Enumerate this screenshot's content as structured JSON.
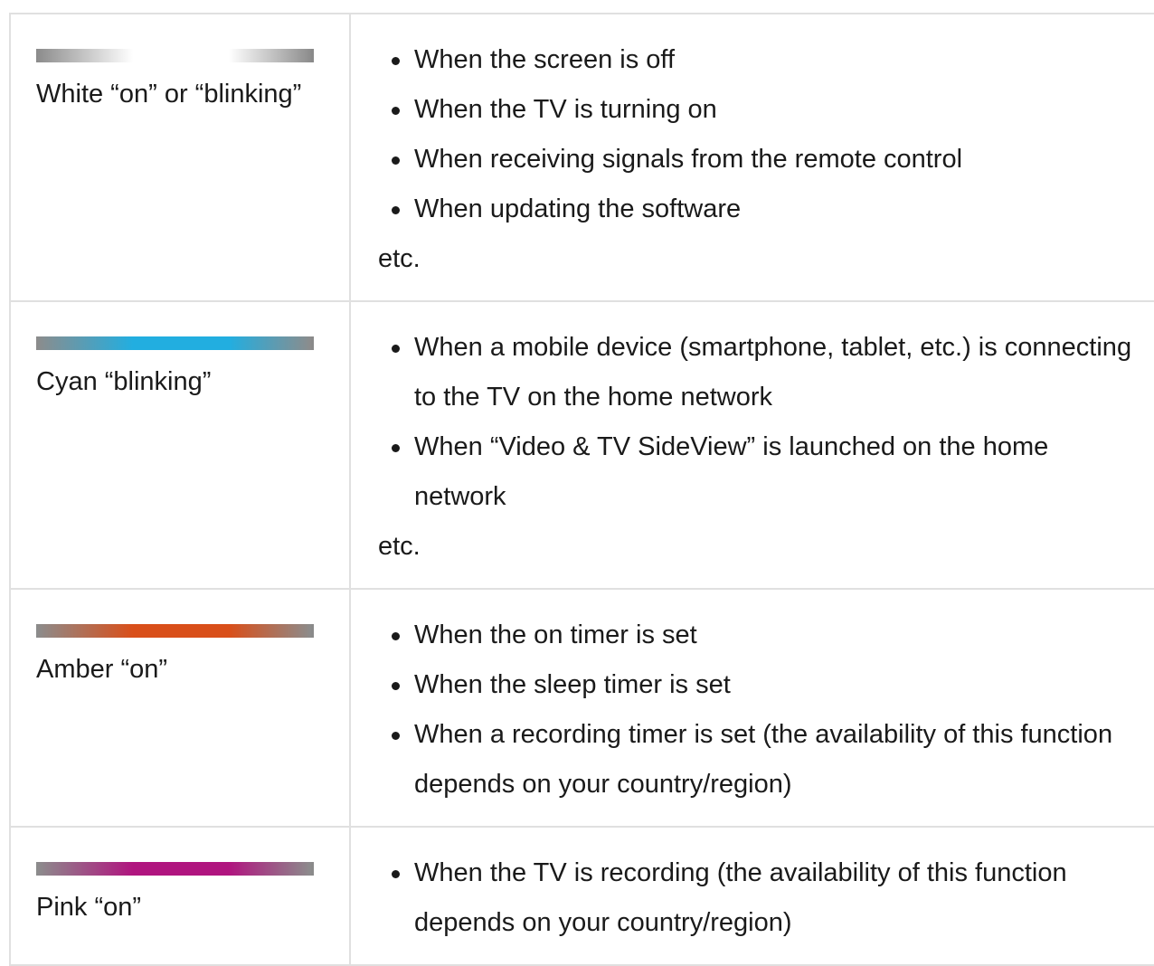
{
  "rows": [
    {
      "label": "White “on” or “blinking”",
      "bar_colors": [
        "#8c8c8c",
        "#ffffff",
        "#8c8c8c"
      ],
      "items": [
        "When the screen is off",
        "When the TV is turning on",
        "When receiving signals from the remote control",
        "When updating the software"
      ],
      "etc": "etc."
    },
    {
      "label": "Cyan “blinking”",
      "bar_colors": [
        "#8c8c8c",
        "#22aee0",
        "#8c8c8c"
      ],
      "items": [
        "When a mobile device (smartphone, tablet, etc.) is connecting to the TV on the home network",
        "When “Video & TV SideView” is launched on the home network"
      ],
      "etc": "etc."
    },
    {
      "label": "Amber “on”",
      "bar_colors": [
        "#8c8c8c",
        "#d94f1a",
        "#8c8c8c"
      ],
      "items": [
        "When the on timer is set",
        "When the sleep timer is set",
        "When a recording timer is set (the availability of this function depends on your country/region)"
      ],
      "etc": ""
    },
    {
      "label": "Pink “on”",
      "bar_colors": [
        "#8c8c8c",
        "#b0157f",
        "#8c8c8c"
      ],
      "items": [
        "When the TV is recording (the availability of this function depends on your country/region)"
      ],
      "etc": ""
    }
  ]
}
